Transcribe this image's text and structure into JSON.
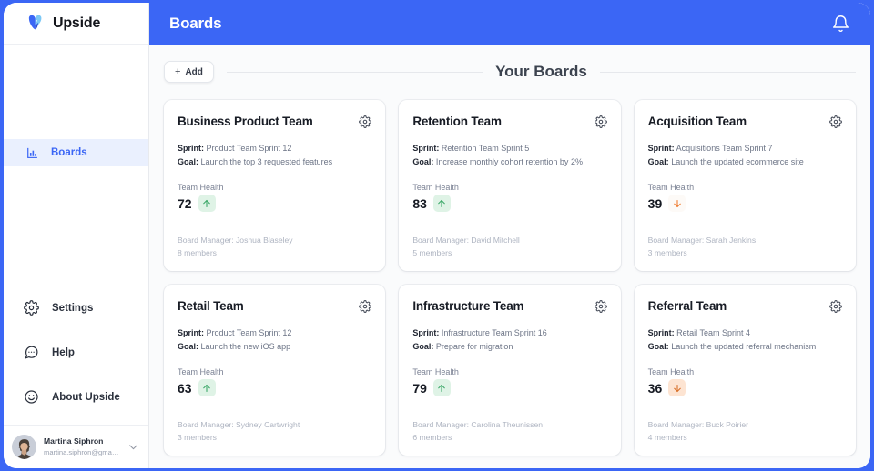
{
  "brand": {
    "name": "Upside",
    "logo_icon": "butterfly-logo-icon",
    "accent": "#3b66f5"
  },
  "topbar": {
    "title": "Boards",
    "bell_icon": "bell-icon"
  },
  "sidebar": {
    "primary_items": [
      {
        "label": "Boards",
        "icon": "bar-chart-icon",
        "active": true
      }
    ],
    "secondary_items": [
      {
        "label": "Settings",
        "icon": "gear-icon"
      },
      {
        "label": "Help",
        "icon": "chat-bubble-icon"
      },
      {
        "label": "About Upside",
        "icon": "smiley-face-icon"
      }
    ],
    "user": {
      "name": "Martina Siphron",
      "email": "martina.siphron@gmail.com",
      "avatar_icon": "user-avatar",
      "chevron_icon": "chevron-down-icon"
    }
  },
  "section": {
    "add_label": "Add",
    "add_plus": "+",
    "title": "Your Boards"
  },
  "labels": {
    "sprint": "Sprint:",
    "goal": "Goal:",
    "team_health": "Team Health",
    "gear_icon": "gear-icon"
  },
  "boards": [
    {
      "title": "Business Product Team",
      "sprint": "Product Team Sprint 12",
      "goal": "Launch the top 3 requested features",
      "health": "72",
      "trend": "up",
      "trend_icon": "arrow-up-icon",
      "manager": "Board Manager: Joshua Blaseley",
      "members": "8 members"
    },
    {
      "title": "Retention Team",
      "sprint": "Retention Team Sprint 5",
      "goal": "Increase monthly cohort retention by 2%",
      "health": "83",
      "trend": "up",
      "trend_icon": "arrow-up-icon",
      "manager": "Board Manager: David Mitchell",
      "members": "5 members"
    },
    {
      "title": "Acquisition Team",
      "sprint": "Acquisitions Team Sprint 7",
      "goal": "Launch the updated ecommerce site",
      "health": "39",
      "trend": "down-faint",
      "trend_icon": "arrow-down-icon",
      "manager": "Board Manager: Sarah Jenkins",
      "members": "3 members"
    },
    {
      "title": "Retail Team",
      "sprint": "Product Team Sprint 12",
      "goal": "Launch the new iOS app",
      "health": "63",
      "trend": "up",
      "trend_icon": "arrow-up-icon",
      "manager": "Board Manager: Sydney Cartwright",
      "members": "3 members"
    },
    {
      "title": "Infrastructure Team",
      "sprint": "Infrastructure Team Sprint 16",
      "goal": "Prepare for migration",
      "health": "79",
      "trend": "up",
      "trend_icon": "arrow-up-icon",
      "manager": "Board Manager: Carolina Theunissen",
      "members": "6 members"
    },
    {
      "title": "Referral Team",
      "sprint": "Retail Team Sprint 4",
      "goal": "Launch the updated referral mechanism",
      "health": "36",
      "trend": "down",
      "trend_icon": "arrow-down-icon",
      "manager": "Board Manager: Buck Poirier",
      "members": "4 members"
    }
  ],
  "colors": {
    "up": "#3ea96a",
    "down": "#ef7f35"
  }
}
